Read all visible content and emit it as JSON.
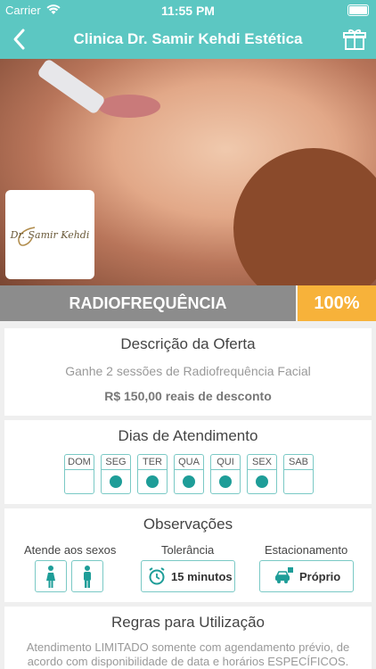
{
  "status_bar": {
    "carrier": "Carrier",
    "time": "11:55 PM"
  },
  "nav": {
    "title": "Clinica Dr. Samir Kehdi Estética",
    "back_icon": "chevron-left-icon",
    "gift_icon": "gift-icon"
  },
  "hero": {
    "logo_text": "Dr. Samir Kehdi"
  },
  "offer": {
    "name": "RADIOFREQUÊNCIA",
    "percent": "100%"
  },
  "description": {
    "title": "Descrição da Oferta",
    "line1": "Ganhe 2 sessões de Radiofrequência Facial",
    "line2": "R$ 150,00 reais de desconto"
  },
  "days": {
    "title": "Dias de Atendimento",
    "items": [
      {
        "label": "DOM",
        "active": false
      },
      {
        "label": "SEG",
        "active": true
      },
      {
        "label": "TER",
        "active": true
      },
      {
        "label": "QUA",
        "active": true
      },
      {
        "label": "QUI",
        "active": true
      },
      {
        "label": "SEX",
        "active": true
      },
      {
        "label": "SAB",
        "active": false
      }
    ]
  },
  "observations": {
    "title": "Observações",
    "sexes_label": "Atende aos sexos",
    "tolerance_label": "Tolerância",
    "tolerance_value": "15 minutos",
    "parking_label": "Estacionamento",
    "parking_value": "Próprio"
  },
  "rules": {
    "title": "Regras para Utilização",
    "text": "Atendimento LIMITADO somente com agendamento prévio, de acordo com disponibilidade de data e horários ESPECÍFICOS."
  },
  "colors": {
    "accent": "#5cc7c2",
    "percent_badge": "#f7b23a",
    "dot": "#1e9d98",
    "offer_bar": "#8c8c8c"
  }
}
